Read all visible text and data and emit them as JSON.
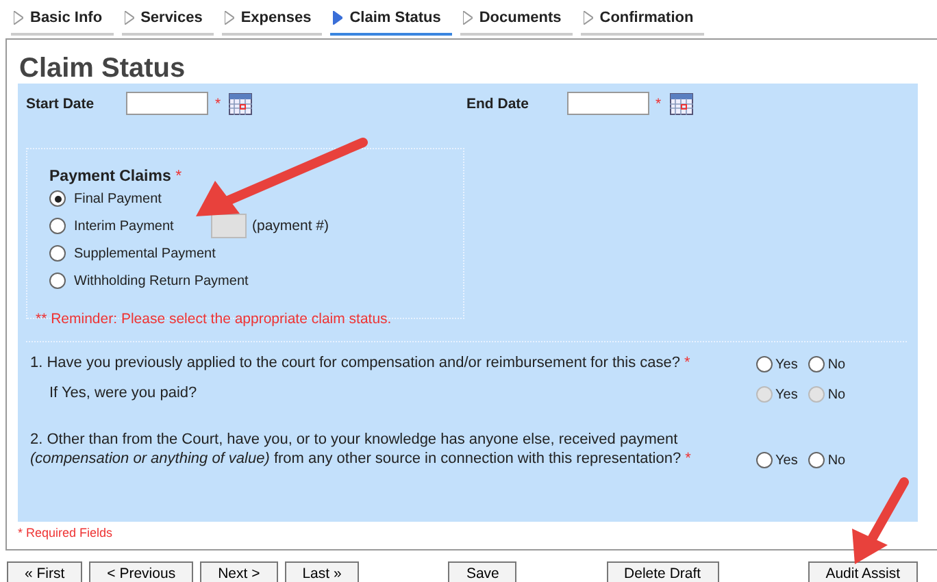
{
  "tabs": [
    {
      "label": "Basic Info",
      "selected": false
    },
    {
      "label": "Services",
      "selected": false
    },
    {
      "label": "Expenses",
      "selected": false
    },
    {
      "label": "Claim Status",
      "selected": true
    },
    {
      "label": "Documents",
      "selected": false
    },
    {
      "label": "Confirmation",
      "selected": false
    }
  ],
  "title": "Claim Status",
  "date_fields": [
    {
      "label": "Start Date",
      "mark": "*"
    },
    {
      "label": "End Date",
      "mark": "*"
    }
  ],
  "payment_claims": {
    "label": "Payment Claims",
    "mark": "*",
    "options": [
      {
        "label": "Final Payment",
        "selected": true
      },
      {
        "label": "Interim Payment",
        "selected": false,
        "suffix": "(payment #)"
      },
      {
        "label": "Supplemental Payment",
        "selected": false
      },
      {
        "label": "Withholding Return Payment",
        "selected": false
      }
    ],
    "reminder": "** Reminder: Please select the appropriate claim status."
  },
  "questions": [
    {
      "kind": "question",
      "text": "1. Have you previously applied to the court for compensation and/or reimbursement for this case?",
      "mark": "*",
      "options": [
        {
          "label": "Yes",
          "selected": false,
          "disabled": false
        },
        {
          "label": "No",
          "selected": false,
          "disabled": false
        }
      ]
    },
    {
      "kind": "sub",
      "text": "If Yes, were you paid?",
      "options": [
        {
          "label": "Yes",
          "selected": false,
          "disabled": true
        },
        {
          "label": "No",
          "selected": false,
          "disabled": true
        }
      ]
    },
    {
      "kind": "question",
      "text": "2. Other than from the Court, have you, or to your knowledge has anyone else, received payment *(compensation or anything of value)* from any other source in connection with this representation?",
      "mark": "*",
      "options": [
        {
          "label": "Yes",
          "selected": false,
          "disabled": false
        },
        {
          "label": "No",
          "selected": false,
          "disabled": false
        }
      ]
    }
  ],
  "required_note": "* Required Fields",
  "buttons": [
    {
      "label": "« First",
      "kind": "nav"
    },
    {
      "label": "< Previous",
      "kind": "nav"
    },
    {
      "label": "Next >",
      "kind": "nav"
    },
    {
      "label": "Last »",
      "kind": "nav"
    },
    {
      "label": "Save",
      "kind": "action"
    },
    {
      "label": "Delete Draft",
      "kind": "action"
    },
    {
      "label": "Audit Assist",
      "kind": "action"
    }
  ]
}
